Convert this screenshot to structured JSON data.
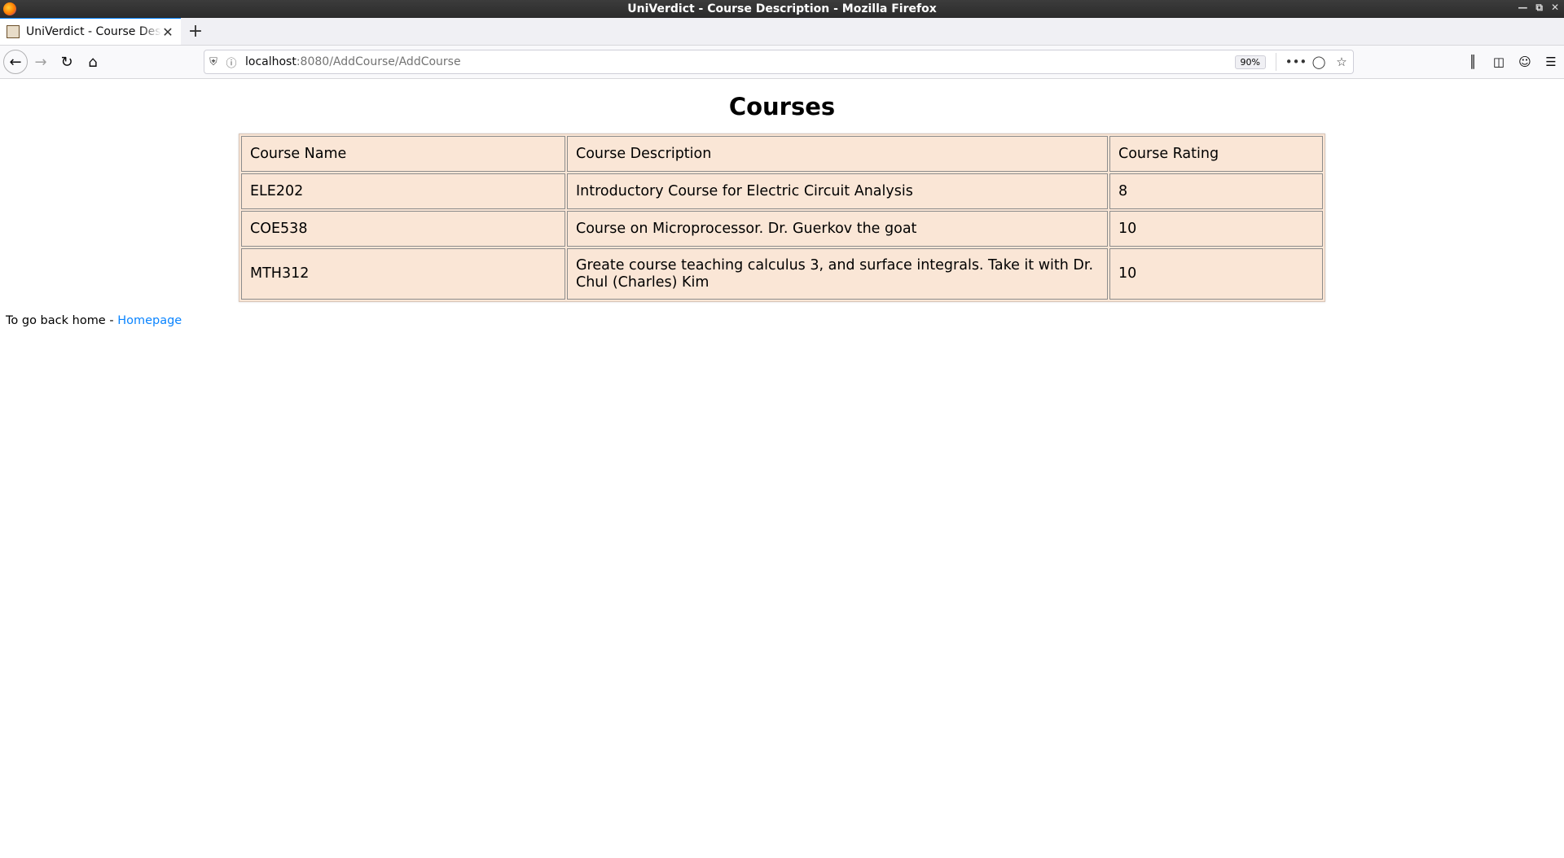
{
  "window": {
    "title": "UniVerdict - Course Description - Mozilla Firefox"
  },
  "tab": {
    "title": "UniVerdict - Course Description",
    "close_glyph": "✕",
    "new_tab_glyph": "+"
  },
  "urlbar": {
    "host": "localhost",
    "path": ":8080/AddCourse/AddCourse",
    "zoom": "90%",
    "page_actions_glyph": "•••"
  },
  "page": {
    "heading": "Courses",
    "table": {
      "headers": [
        "Course Name",
        "Course Description",
        "Course Rating"
      ],
      "rows": [
        [
          "ELE202",
          "Introductory Course for Electric Circuit Analysis",
          "8"
        ],
        [
          "COE538",
          "Course on Microprocessor. Dr. Guerkov the goat",
          "10"
        ],
        [
          "MTH312",
          "Greate course teaching calculus 3, and surface integrals. Take it with Dr. Chul (Charles) Kim",
          "10"
        ]
      ]
    },
    "footer_text": "To go back home - ",
    "footer_link": "Homepage"
  },
  "icons": {
    "back": "back-arrow-icon",
    "forward": "forward-arrow-icon",
    "reload": "reload-icon",
    "home": "home-icon",
    "shield": "tracking-shield-icon",
    "info": "site-info-icon",
    "pocket": "pocket-icon",
    "bookmark": "bookmark-star-icon",
    "library": "library-icon",
    "sidebar": "sidebar-icon",
    "account": "account-icon",
    "menu": "hamburger-menu-icon"
  },
  "colors": {
    "table_bg": "#fae6d6",
    "link": "#0a84ff",
    "tab_accent": "#0a84ff"
  }
}
